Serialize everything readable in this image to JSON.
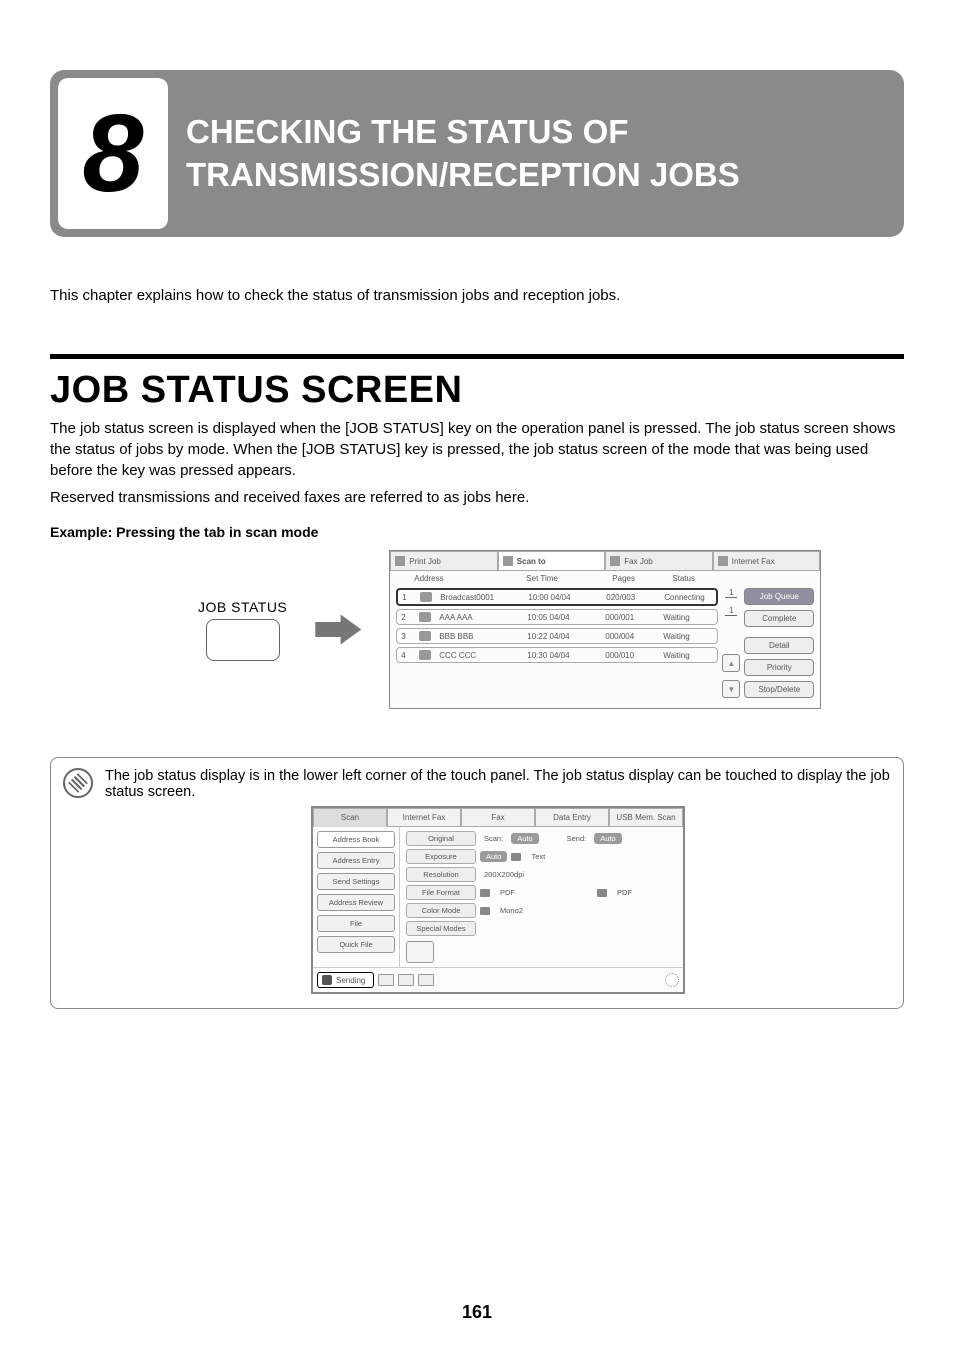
{
  "chapter": {
    "number": "8",
    "title": "CHECKING THE STATUS OF TRANSMISSION/RECEPTION JOBS"
  },
  "intro": "This chapter explains how to check the status of transmission jobs and reception jobs.",
  "section_heading": "JOB STATUS SCREEN",
  "para1": "The job status screen is displayed when the [JOB STATUS] key on the operation panel is pressed. The job status screen shows the status of jobs by mode. When the [JOB STATUS] key is pressed, the job status screen of the mode that was being used before the key was pressed appears.",
  "para2": "Reserved transmissions and received faxes are referred to as jobs here.",
  "example_label": "Example: Pressing the tab in scan mode",
  "jobstatus_label": "JOB STATUS",
  "job_tabs": [
    "Print Job",
    "Scan to",
    "Fax Job",
    "Internet Fax"
  ],
  "job_headers": {
    "address": "Address",
    "set_time": "Set Time",
    "pages": "Pages",
    "status": "Status"
  },
  "job_rows": [
    {
      "idx": "1",
      "addr": "Broadcast0001",
      "time": "10:00 04/04",
      "pages": "020/003",
      "status": "Connecting"
    },
    {
      "idx": "2",
      "addr": "AAA AAA",
      "time": "10:05 04/04",
      "pages": "000/001",
      "status": "Waiting"
    },
    {
      "idx": "3",
      "addr": "BBB BBB",
      "time": "10:22 04/04",
      "pages": "000/004",
      "status": "Waiting"
    },
    {
      "idx": "4",
      "addr": "CCC CCC",
      "time": "10:30 04/04",
      "pages": "000/010",
      "status": "Waiting"
    }
  ],
  "side_numbers": {
    "top": "1",
    "bottom": "1"
  },
  "right_buttons": {
    "queue": "Job Queue",
    "complete": "Complete",
    "detail": "Detail",
    "priority": "Priority",
    "stop": "Stop/Delete"
  },
  "note_text": "The job status display is in the lower left corner of the touch panel. The job status display can be touched to display the job status screen.",
  "scan_tabs": [
    "Scan",
    "Internet Fax",
    "Fax",
    "Data Entry",
    "USB Mem. Scan"
  ],
  "scan_sidebar": [
    "Address Book",
    "Address Entry",
    "Send Settings",
    "Address Review",
    "File",
    "Quick File"
  ],
  "scan_props": {
    "original": {
      "label": "Original",
      "scan_prefix": "Scan:",
      "scan_val": "Auto",
      "send_prefix": "Send:",
      "send_val": "Auto"
    },
    "exposure": {
      "label": "Exposure",
      "val": "Auto",
      "extra": "Text"
    },
    "resolution": {
      "label": "Resolution",
      "val": "200X200dpi"
    },
    "fileformat": {
      "label": "File Format",
      "pdf1": "PDF",
      "pdf2": "PDF"
    },
    "colormode": {
      "label": "Color Mode",
      "val": "Mono2"
    },
    "special": {
      "label": "Special Modes"
    }
  },
  "send_status": "Sending",
  "page_number": "161"
}
